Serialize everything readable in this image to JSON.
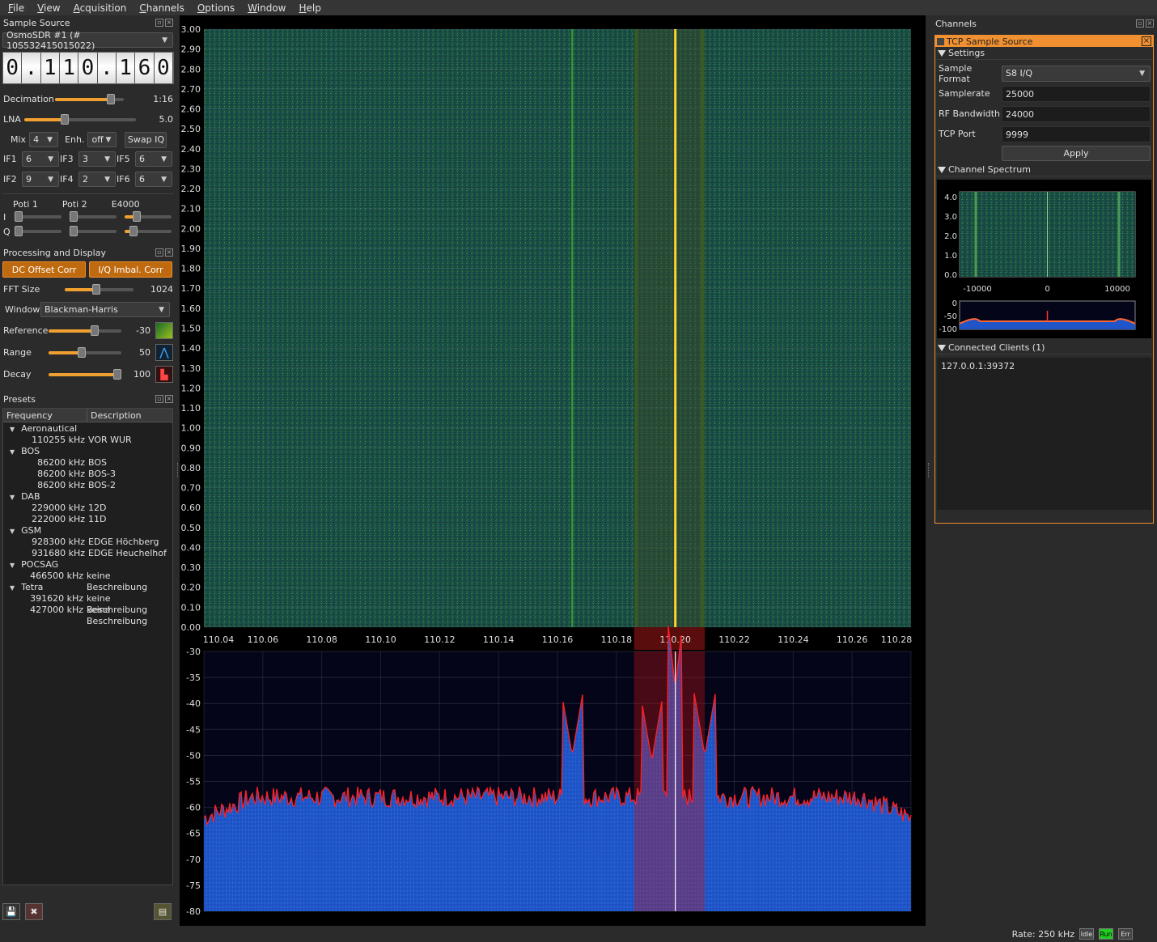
{
  "menu": [
    "File",
    "View",
    "Acquisition",
    "Channels",
    "Options",
    "Window",
    "Help"
  ],
  "sample_source": {
    "title": "Sample Source",
    "device": "OsmoSDR #1 (# 10S532415015022)",
    "frequency_digits": [
      "0",
      ".",
      "1",
      "1",
      "0",
      ".",
      "1",
      "6",
      "0"
    ],
    "decimation_label": "Decimation",
    "decimation_value": "1:16",
    "decimation_level": 0.85,
    "lna_label": "LNA",
    "lna_value": "5.0",
    "lna_level": 0.35,
    "mix_label": "Mix",
    "mix_value": "4",
    "enh_label": "Enh.",
    "enh_value": "off",
    "swap_iq": "Swap IQ",
    "if": [
      {
        "label": "IF1",
        "value": "6"
      },
      {
        "label": "IF3",
        "value": "3"
      },
      {
        "label": "IF5",
        "value": "6"
      },
      {
        "label": "IF2",
        "value": "9"
      },
      {
        "label": "IF4",
        "value": "2"
      },
      {
        "label": "IF6",
        "value": "6"
      }
    ],
    "poti_labels": [
      "Poti 1",
      "Poti 2",
      "E4000"
    ],
    "i_label": "I",
    "q_label": "Q"
  },
  "processing": {
    "title": "Processing and Display",
    "dc_offset": "DC Offset Corr",
    "iq_imbal": "I/Q Imbal. Corr",
    "fft_label": "FFT Size",
    "fft_value": "1024",
    "fft_level": 0.45,
    "window_label": "Window",
    "window_value": "Blackman-Harris",
    "reference_label": "Reference",
    "reference_value": "-30",
    "reference_level": 0.65,
    "range_label": "Range",
    "range_value": "50",
    "range_level": 0.45,
    "decay_label": "Decay",
    "decay_value": "100",
    "decay_level": 1.0
  },
  "presets": {
    "title": "Presets",
    "col_frequency": "Frequency",
    "col_description": "Description",
    "groups": [
      {
        "name": "Aeronautical",
        "items": [
          {
            "f": "110255 kHz",
            "d": "VOR WUR"
          }
        ]
      },
      {
        "name": "BOS",
        "items": [
          {
            "f": "86200 kHz",
            "d": "BOS"
          },
          {
            "f": "86200 kHz",
            "d": "BOS-3"
          },
          {
            "f": "86200 kHz",
            "d": "BOS-2"
          }
        ]
      },
      {
        "name": "DAB",
        "items": [
          {
            "f": "229000 kHz",
            "d": "12D"
          },
          {
            "f": "222000 kHz",
            "d": "11D"
          }
        ]
      },
      {
        "name": "GSM",
        "items": [
          {
            "f": "928300 kHz",
            "d": "EDGE Höchberg"
          },
          {
            "f": "931680 kHz",
            "d": "EDGE Heuchelhof"
          }
        ]
      },
      {
        "name": "POCSAG",
        "items": [
          {
            "f": "466500 kHz",
            "d": "keine Beschreibung"
          }
        ]
      },
      {
        "name": "Tetra",
        "items": [
          {
            "f": "391620 kHz",
            "d": "keine Beschreibung"
          },
          {
            "f": "427000 kHz",
            "d": "keine Beschreibung"
          }
        ]
      }
    ]
  },
  "waterfall": {
    "y_ticks": [
      "3.00",
      "2.90",
      "2.80",
      "2.70",
      "2.60",
      "2.50",
      "2.40",
      "2.30",
      "2.20",
      "2.10",
      "2.00",
      "1.90",
      "1.80",
      "1.70",
      "1.60",
      "1.50",
      "1.40",
      "1.30",
      "1.20",
      "1.10",
      "1.00",
      "0.90",
      "0.80",
      "0.70",
      "0.60",
      "0.50",
      "0.40",
      "0.30",
      "0.20",
      "0.10",
      "0.00"
    ],
    "x_ticks": [
      "110.04",
      "110.06",
      "110.08",
      "110.10",
      "110.12",
      "110.14",
      "110.16",
      "110.18",
      "110.20",
      "110.22",
      "110.24",
      "110.26",
      "110.28"
    ],
    "x_range": [
      110.04,
      110.28
    ],
    "signal_freq": 110.2,
    "band": [
      110.186,
      110.21
    ],
    "spur_freq": 110.165
  },
  "spectrum": {
    "y_ticks": [
      "-30",
      "-35",
      "-40",
      "-45",
      "-50",
      "-55",
      "-60",
      "-65",
      "-70",
      "-75",
      "-80"
    ],
    "ylim": [
      -80,
      -30
    ],
    "noise_floor": -58,
    "peaks": [
      {
        "f": 110.165,
        "db": -50
      },
      {
        "f": 110.192,
        "db": -51
      },
      {
        "f": 110.2,
        "db": -37
      },
      {
        "f": 110.21,
        "db": -50
      }
    ]
  },
  "channels": {
    "title": "Channels",
    "plugin_title": "TCP Sample Source",
    "settings_label": "Settings",
    "fields": [
      {
        "label": "Sample Format",
        "value": "S8 I/Q",
        "combo": true
      },
      {
        "label": "Samplerate",
        "value": "25000"
      },
      {
        "label": "RF Bandwidth",
        "value": "24000"
      },
      {
        "label": "TCP Port",
        "value": "9999"
      }
    ],
    "apply": "Apply",
    "channel_spectrum_label": "Channel Spectrum",
    "mini_y_ticks": [
      "4.0",
      "3.0",
      "2.0",
      "1.0",
      "0.0"
    ],
    "mini_x_ticks": [
      "-10000",
      "0",
      "10000"
    ],
    "mini_db_ticks": [
      "0",
      "-50",
      "-100"
    ],
    "clients_label": "Connected Clients (1)",
    "clients": [
      "127.0.0.1:39372"
    ]
  },
  "status": {
    "rate": "Rate: 250 kHz",
    "idle": "Idle",
    "run": "Run",
    "err": "Err"
  },
  "colors": {
    "accent": "#f09030",
    "waterfall_bg": "#1e5a48",
    "spectrum_fill": "#1f55c8",
    "spectrum_line": "#ff2020",
    "signal": "#ffd030"
  }
}
